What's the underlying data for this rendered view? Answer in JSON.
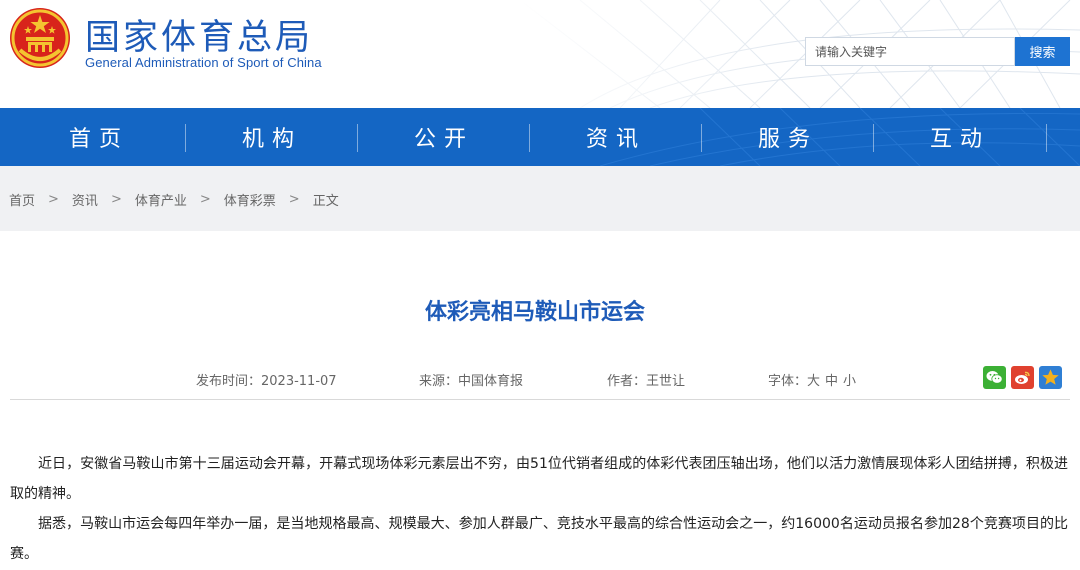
{
  "header": {
    "title_cn": "国家体育总局",
    "title_en": "General Administration of Sport of China"
  },
  "search": {
    "placeholder": "请输入关键字",
    "button_label": "搜索"
  },
  "nav": {
    "items": [
      {
        "label": "首页"
      },
      {
        "label": "机构"
      },
      {
        "label": "公开"
      },
      {
        "label": "资讯"
      },
      {
        "label": "服务"
      },
      {
        "label": "互动"
      }
    ]
  },
  "breadcrumb": {
    "items": [
      "首页",
      "资讯",
      "体育产业",
      "体育彩票",
      "正文"
    ],
    "separator": ">"
  },
  "article": {
    "title": "体彩亮相马鞍山市运会",
    "meta": {
      "date_label": "发布时间：",
      "date": "2023-11-07",
      "source_label": "来源：",
      "source": "中国体育报",
      "author_label": "作者：",
      "author": "王世让",
      "font_label": "字体：",
      "font_large": "大",
      "font_medium": "中",
      "font_small": "小"
    },
    "paragraphs": [
      "近日，安徽省马鞍山市第十三届运动会开幕，开幕式现场体彩元素层出不穷，由51位代销者组成的体彩代表团压轴出场，他们以活力激情展现体彩人团结拼搏，积极进取的精神。",
      "据悉，马鞍山市运会每四年举办一届，是当地规格最高、规模最大、参加人群最广、竞技水平最高的综合性运动会之一，约16000名运动员报名参加28个竞赛项目的比赛。"
    ]
  },
  "share": {
    "icons": [
      "wechat-icon",
      "weibo-icon",
      "favorite-star-icon"
    ]
  },
  "colors": {
    "brand_blue": "#1e5bb8",
    "nav_blue": "#1466c4",
    "search_button": "#1e73d2",
    "wechat_green": "#3cb035",
    "weibo_red": "#e0412f",
    "star_yellow": "#f2b01e"
  }
}
